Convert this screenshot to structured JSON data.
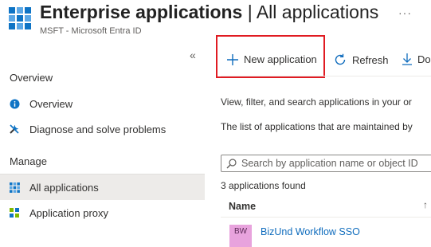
{
  "header": {
    "title_main": "Enterprise applications",
    "title_rest": " | All applications",
    "subtitle": "MSFT - Microsoft Entra ID",
    "more": "···"
  },
  "sidebar": {
    "collapse": "«",
    "sections": [
      {
        "heading": "Overview",
        "items": [
          {
            "label": "Overview",
            "icon": "info-icon"
          },
          {
            "label": "Diagnose and solve problems",
            "icon": "wrench-icon"
          }
        ]
      },
      {
        "heading": "Manage",
        "items": [
          {
            "label": "All applications",
            "icon": "grid-icon",
            "active": true
          },
          {
            "label": "Application proxy",
            "icon": "proxy-icon"
          }
        ]
      }
    ]
  },
  "toolbar": {
    "new_application": "New application",
    "refresh": "Refresh",
    "download": "Do"
  },
  "main": {
    "description_1": "View, filter, and search applications in your or",
    "description_2": "The list of applications that are maintained by",
    "search_placeholder": "Search by application name or object ID",
    "count": "3 applications found",
    "column_name": "Name",
    "sort_icon": "↑",
    "rows": [
      {
        "avatar": "BW",
        "name": "BizUnd Workflow SSO"
      }
    ]
  },
  "colors": {
    "accent": "#0f6cbd",
    "highlight_border": "#e01b22",
    "active_nav": "#edebe9"
  }
}
